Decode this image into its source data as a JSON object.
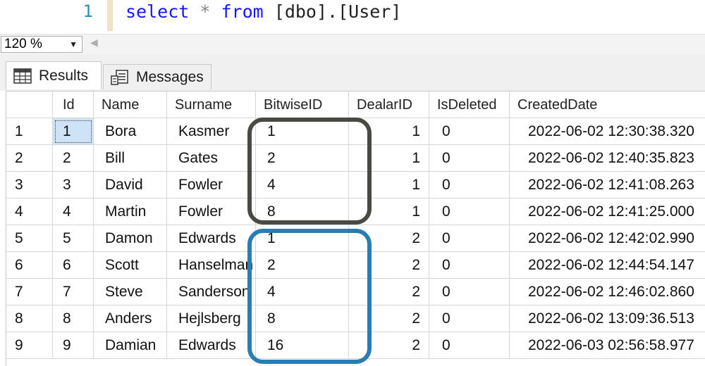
{
  "editor": {
    "line_number": "1",
    "code": {
      "kw_select": "select",
      "star": "*",
      "kw_from": "from",
      "object": "[dbo].[User]"
    }
  },
  "zoom": {
    "value": "120 %"
  },
  "tabs": [
    {
      "label": "Results",
      "icon": "grid-icon",
      "active": true
    },
    {
      "label": "Messages",
      "icon": "messages-icon",
      "active": false
    }
  ],
  "grid": {
    "columns": [
      "Id",
      "Name",
      "Surname",
      "BitwiseID",
      "DealarID",
      "IsDeleted",
      "CreatedDate"
    ],
    "rows": [
      {
        "n": "1",
        "cells": [
          "1",
          "Bora",
          "Kasmer",
          "1",
          "1",
          "0",
          "2022-06-02 12:30:38.320"
        ]
      },
      {
        "n": "2",
        "cells": [
          "2",
          "Bill",
          "Gates",
          "2",
          "1",
          "0",
          "2022-06-02 12:40:35.823"
        ]
      },
      {
        "n": "3",
        "cells": [
          "3",
          "David",
          "Fowler",
          "4",
          "1",
          "0",
          "2022-06-02 12:41:08.263"
        ]
      },
      {
        "n": "4",
        "cells": [
          "4",
          "Martin",
          "Fowler",
          "8",
          "1",
          "0",
          "2022-06-02 12:41:25.000"
        ]
      },
      {
        "n": "5",
        "cells": [
          "5",
          "Damon",
          "Edwards",
          "1",
          "2",
          "0",
          "2022-06-02 12:42:02.990"
        ]
      },
      {
        "n": "6",
        "cells": [
          "6",
          "Scott",
          "Hanselman",
          "2",
          "2",
          "0",
          "2022-06-02 12:44:54.147"
        ]
      },
      {
        "n": "7",
        "cells": [
          "7",
          "Steve",
          "Sanderson",
          "4",
          "2",
          "0",
          "2022-06-02 12:46:02.860"
        ]
      },
      {
        "n": "8",
        "cells": [
          "8",
          "Anders",
          "Hejlsberg",
          "8",
          "2",
          "0",
          "2022-06-02 13:09:36.513"
        ]
      },
      {
        "n": "9",
        "cells": [
          "9",
          "Damian",
          "Edwards",
          "16",
          "2",
          "0",
          "2022-06-03 02:56:58.977"
        ]
      }
    ]
  },
  "colors": {
    "keyword": "#1717ff",
    "annotation_dealer_1": "#4a4a44",
    "annotation_dealer_2": "#2a7db1"
  }
}
